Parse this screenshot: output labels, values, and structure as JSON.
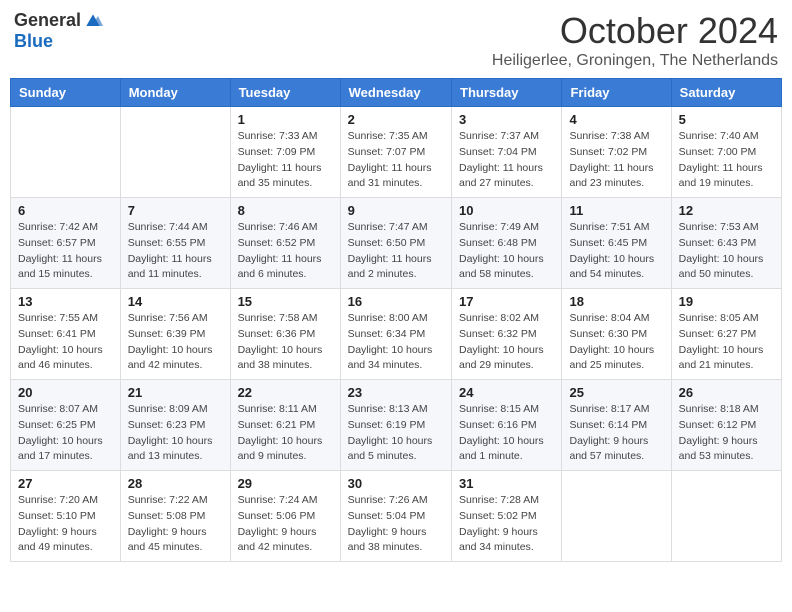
{
  "header": {
    "logo_general": "General",
    "logo_blue": "Blue",
    "month_title": "October 2024",
    "location": "Heiligerlee, Groningen, The Netherlands"
  },
  "weekdays": [
    "Sunday",
    "Monday",
    "Tuesday",
    "Wednesday",
    "Thursday",
    "Friday",
    "Saturday"
  ],
  "weeks": [
    [
      {
        "day": "",
        "info": ""
      },
      {
        "day": "",
        "info": ""
      },
      {
        "day": "1",
        "info": "Sunrise: 7:33 AM\nSunset: 7:09 PM\nDaylight: 11 hours and 35 minutes."
      },
      {
        "day": "2",
        "info": "Sunrise: 7:35 AM\nSunset: 7:07 PM\nDaylight: 11 hours and 31 minutes."
      },
      {
        "day": "3",
        "info": "Sunrise: 7:37 AM\nSunset: 7:04 PM\nDaylight: 11 hours and 27 minutes."
      },
      {
        "day": "4",
        "info": "Sunrise: 7:38 AM\nSunset: 7:02 PM\nDaylight: 11 hours and 23 minutes."
      },
      {
        "day": "5",
        "info": "Sunrise: 7:40 AM\nSunset: 7:00 PM\nDaylight: 11 hours and 19 minutes."
      }
    ],
    [
      {
        "day": "6",
        "info": "Sunrise: 7:42 AM\nSunset: 6:57 PM\nDaylight: 11 hours and 15 minutes."
      },
      {
        "day": "7",
        "info": "Sunrise: 7:44 AM\nSunset: 6:55 PM\nDaylight: 11 hours and 11 minutes."
      },
      {
        "day": "8",
        "info": "Sunrise: 7:46 AM\nSunset: 6:52 PM\nDaylight: 11 hours and 6 minutes."
      },
      {
        "day": "9",
        "info": "Sunrise: 7:47 AM\nSunset: 6:50 PM\nDaylight: 11 hours and 2 minutes."
      },
      {
        "day": "10",
        "info": "Sunrise: 7:49 AM\nSunset: 6:48 PM\nDaylight: 10 hours and 58 minutes."
      },
      {
        "day": "11",
        "info": "Sunrise: 7:51 AM\nSunset: 6:45 PM\nDaylight: 10 hours and 54 minutes."
      },
      {
        "day": "12",
        "info": "Sunrise: 7:53 AM\nSunset: 6:43 PM\nDaylight: 10 hours and 50 minutes."
      }
    ],
    [
      {
        "day": "13",
        "info": "Sunrise: 7:55 AM\nSunset: 6:41 PM\nDaylight: 10 hours and 46 minutes."
      },
      {
        "day": "14",
        "info": "Sunrise: 7:56 AM\nSunset: 6:39 PM\nDaylight: 10 hours and 42 minutes."
      },
      {
        "day": "15",
        "info": "Sunrise: 7:58 AM\nSunset: 6:36 PM\nDaylight: 10 hours and 38 minutes."
      },
      {
        "day": "16",
        "info": "Sunrise: 8:00 AM\nSunset: 6:34 PM\nDaylight: 10 hours and 34 minutes."
      },
      {
        "day": "17",
        "info": "Sunrise: 8:02 AM\nSunset: 6:32 PM\nDaylight: 10 hours and 29 minutes."
      },
      {
        "day": "18",
        "info": "Sunrise: 8:04 AM\nSunset: 6:30 PM\nDaylight: 10 hours and 25 minutes."
      },
      {
        "day": "19",
        "info": "Sunrise: 8:05 AM\nSunset: 6:27 PM\nDaylight: 10 hours and 21 minutes."
      }
    ],
    [
      {
        "day": "20",
        "info": "Sunrise: 8:07 AM\nSunset: 6:25 PM\nDaylight: 10 hours and 17 minutes."
      },
      {
        "day": "21",
        "info": "Sunrise: 8:09 AM\nSunset: 6:23 PM\nDaylight: 10 hours and 13 minutes."
      },
      {
        "day": "22",
        "info": "Sunrise: 8:11 AM\nSunset: 6:21 PM\nDaylight: 10 hours and 9 minutes."
      },
      {
        "day": "23",
        "info": "Sunrise: 8:13 AM\nSunset: 6:19 PM\nDaylight: 10 hours and 5 minutes."
      },
      {
        "day": "24",
        "info": "Sunrise: 8:15 AM\nSunset: 6:16 PM\nDaylight: 10 hours and 1 minute."
      },
      {
        "day": "25",
        "info": "Sunrise: 8:17 AM\nSunset: 6:14 PM\nDaylight: 9 hours and 57 minutes."
      },
      {
        "day": "26",
        "info": "Sunrise: 8:18 AM\nSunset: 6:12 PM\nDaylight: 9 hours and 53 minutes."
      }
    ],
    [
      {
        "day": "27",
        "info": "Sunrise: 7:20 AM\nSunset: 5:10 PM\nDaylight: 9 hours and 49 minutes."
      },
      {
        "day": "28",
        "info": "Sunrise: 7:22 AM\nSunset: 5:08 PM\nDaylight: 9 hours and 45 minutes."
      },
      {
        "day": "29",
        "info": "Sunrise: 7:24 AM\nSunset: 5:06 PM\nDaylight: 9 hours and 42 minutes."
      },
      {
        "day": "30",
        "info": "Sunrise: 7:26 AM\nSunset: 5:04 PM\nDaylight: 9 hours and 38 minutes."
      },
      {
        "day": "31",
        "info": "Sunrise: 7:28 AM\nSunset: 5:02 PM\nDaylight: 9 hours and 34 minutes."
      },
      {
        "day": "",
        "info": ""
      },
      {
        "day": "",
        "info": ""
      }
    ]
  ]
}
